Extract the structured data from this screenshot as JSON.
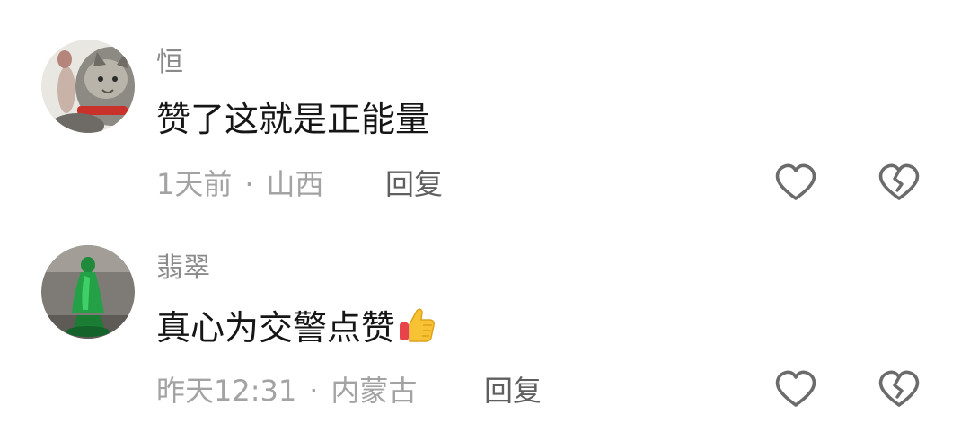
{
  "comments": [
    {
      "username": "恒",
      "text": "赞了这就是正能量",
      "time": "1天前",
      "separator": "·",
      "location": "山西",
      "reply_label": "回复",
      "avatar_icon": "cat-avatar-icon",
      "like_icon": "heart-outline-icon",
      "dislike_icon": "broken-heart-icon"
    },
    {
      "username": "翡翠",
      "text": "真心为交警点赞",
      "emoji": "thumbs-up-emoji",
      "time": "昨天12:31",
      "separator": "·",
      "location": "内蒙古",
      "reply_label": "回复",
      "avatar_icon": "jade-statue-avatar-icon",
      "like_icon": "heart-outline-icon",
      "dislike_icon": "broken-heart-icon"
    }
  ],
  "colors": {
    "username": "#8a8a8a",
    "text": "#161616",
    "meta": "#a3a3a3",
    "reply": "#5f5f5f",
    "icon_stroke": "#6b6b6b"
  }
}
